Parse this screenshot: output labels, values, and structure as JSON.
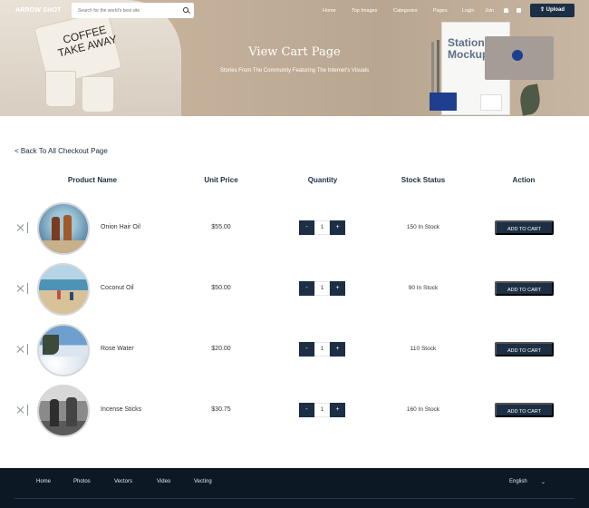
{
  "nav": {
    "logo": "ARROW SHOT",
    "search_placeholder": "Search for the world's best site",
    "menu": [
      "Home",
      "Top Images",
      "Categories",
      "Pages",
      "Login",
      "Join"
    ],
    "upload_label": "Upload"
  },
  "hero": {
    "title": "View Cart Page",
    "subtitle": "Stories From The Community Featuring The Internet's Visuals",
    "mock_text": "Station Mockup",
    "cup_text": "COFFEE TAKE AWAY"
  },
  "back_link": "< Back To All Checkout Page",
  "table": {
    "headers": [
      "Product Name",
      "Unit Price",
      "Quantity",
      "Stock Status",
      "Action"
    ],
    "rows": [
      {
        "name": "Onion Hair Oil",
        "price": "$55.00",
        "qty": "1",
        "stock": "150 In Stock",
        "action": "ADD TO CART",
        "thumb": "bottles-beach"
      },
      {
        "name": "Coconut Oil",
        "price": "$50.00",
        "qty": "1",
        "stock": "90 In Stock",
        "action": "ADD TO CART",
        "thumb": "beach-people"
      },
      {
        "name": "Rose Water",
        "price": "$20.00",
        "qty": "1",
        "stock": "110 Stock",
        "action": "ADD TO CART",
        "thumb": "clouds-sky"
      },
      {
        "name": "Incense Sticks",
        "price": "$30.75",
        "qty": "1",
        "stock": "160 In Stock",
        "action": "ADD TO CART",
        "thumb": "bw-crowd"
      }
    ]
  },
  "qty_minus": "-",
  "qty_plus": "+",
  "footer": {
    "links": [
      "Home",
      "Photos",
      "Vectors",
      "Video",
      "Vecting"
    ],
    "right": "English"
  }
}
